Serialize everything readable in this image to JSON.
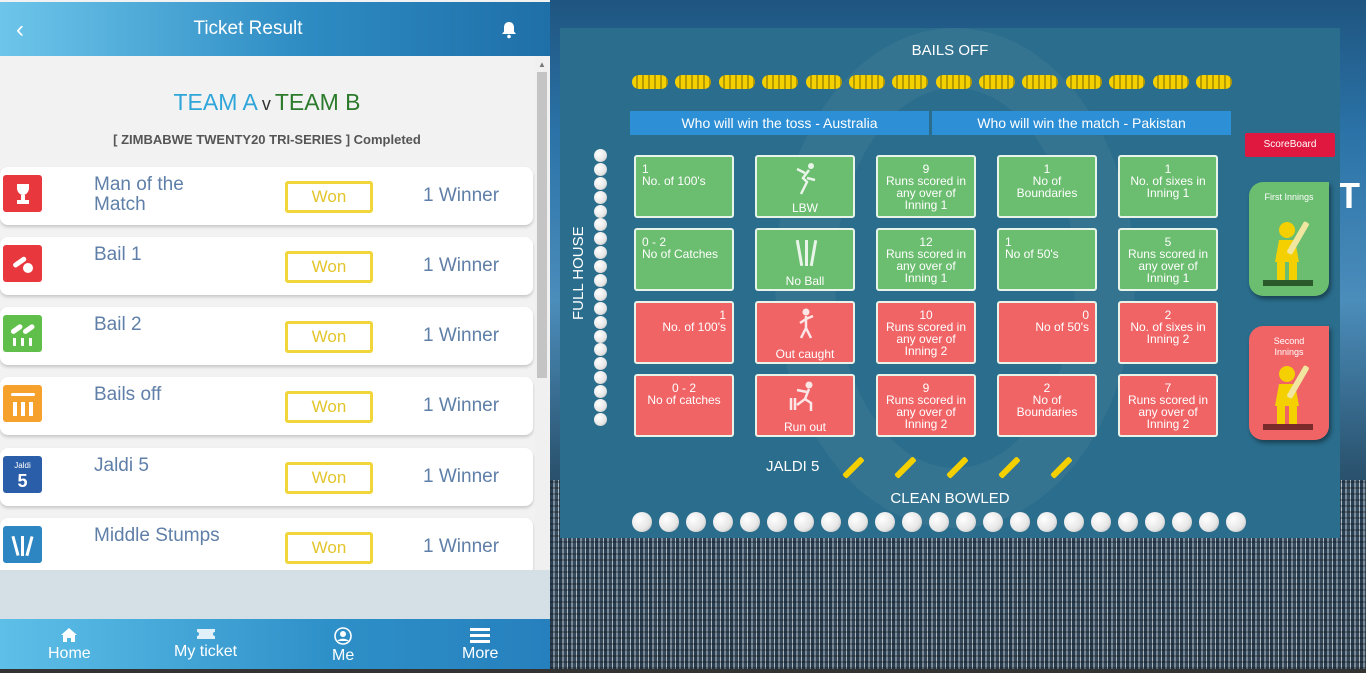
{
  "header": {
    "back_icon": "chevron-left-icon",
    "title": "Ticket Result",
    "bell_icon": "bell-icon"
  },
  "match": {
    "team_a": "TEAM A",
    "vs": "v",
    "team_b": "TEAM B",
    "series": "[ ZIMBABWE TWENTY20 TRI-SERIES ] Completed",
    "colors": {
      "team_a": "#2fa6da",
      "team_b": "#2c7a2c"
    }
  },
  "results": [
    {
      "name": "Man of the Match",
      "status": "Won",
      "winners": "1 Winner",
      "icon": "trophy-icon",
      "color": "#e8383d"
    },
    {
      "name": "Bail 1",
      "status": "Won",
      "winners": "1 Winner",
      "icon": "bail-ball-icon",
      "color": "#e8383d"
    },
    {
      "name": "Bail 2",
      "status": "Won",
      "winners": "1 Winner",
      "icon": "bails-icon",
      "color": "#5fbf4a"
    },
    {
      "name": "Bails off",
      "status": "Won",
      "winners": "1 Winner",
      "icon": "stumps-bails-icon",
      "color": "#f5a12c"
    },
    {
      "name": "Jaldi 5",
      "status": "Won",
      "winners": "1 Winner",
      "icon": "jaldi-5-icon",
      "icon_text": "Jaldi",
      "icon_num": "5",
      "color": "#2b5ea8"
    },
    {
      "name": "Middle Stumps",
      "status": "Won",
      "winners": "1 Winner",
      "icon": "middle-stumps-icon",
      "color": "#2d86c1"
    }
  ],
  "nav": [
    {
      "label": "Home",
      "icon": "home-icon"
    },
    {
      "label": "My ticket",
      "icon": "ticket-icon"
    },
    {
      "label": "Me",
      "icon": "user-icon"
    },
    {
      "label": "More",
      "icon": "menu-icon"
    }
  ],
  "board": {
    "bails_off": "BAILS OFF",
    "toss": "Who will win the toss - Australia",
    "match_winner": "Who will win the match - Pakistan",
    "full_house": "FULL HOUSE",
    "jaldi_5": "JALDI 5",
    "clean_bowled": "CLEAN BOWLED",
    "scoreboard": "ScoreBoard",
    "first_innings": "First Innings",
    "second_innings": "Second Innings",
    "colors": {
      "green": "#6bbd6f",
      "red": "#f06466",
      "scoreboard": "#e0173f"
    },
    "cells": [
      {
        "num": "1",
        "text": "No. of 100's",
        "color": "g"
      },
      {
        "num": "",
        "text": "LBW",
        "color": "g"
      },
      {
        "num": "9",
        "text": "Runs scored in any over of Inning 1",
        "color": "g"
      },
      {
        "num": "1",
        "text": "No of Boundaries",
        "color": "g"
      },
      {
        "num": "1",
        "text": "No. of sixes in Inning 1",
        "color": "g"
      },
      {
        "num": "0 - 2",
        "text": "No of Catches",
        "color": "g"
      },
      {
        "num": "",
        "text": "No Ball",
        "color": "g"
      },
      {
        "num": "12",
        "text": "Runs scored in any over of Inning 1",
        "color": "g"
      },
      {
        "num": "1",
        "text": "No of 50's",
        "color": "g"
      },
      {
        "num": "5",
        "text": "Runs scored in any over of Inning 1",
        "color": "g"
      },
      {
        "num": "1",
        "text": "No. of 100's",
        "color": "r"
      },
      {
        "num": "",
        "text": "Out caught",
        "color": "r"
      },
      {
        "num": "10",
        "text": "Runs scored in any over of Inning 2",
        "color": "r"
      },
      {
        "num": "0",
        "text": "No of 50's",
        "color": "r"
      },
      {
        "num": "2",
        "text": "No. of sixes in Inning 2",
        "color": "r"
      },
      {
        "num": "0 - 2",
        "text": "No of catches",
        "color": "r"
      },
      {
        "num": "",
        "text": "Run out",
        "color": "r"
      },
      {
        "num": "9",
        "text": "Runs scored in any over of Inning 2",
        "color": "r"
      },
      {
        "num": "2",
        "text": "No of Boundaries",
        "color": "r"
      },
      {
        "num": "7",
        "text": "Runs scored in any over of Inning 2",
        "color": "r"
      }
    ]
  }
}
